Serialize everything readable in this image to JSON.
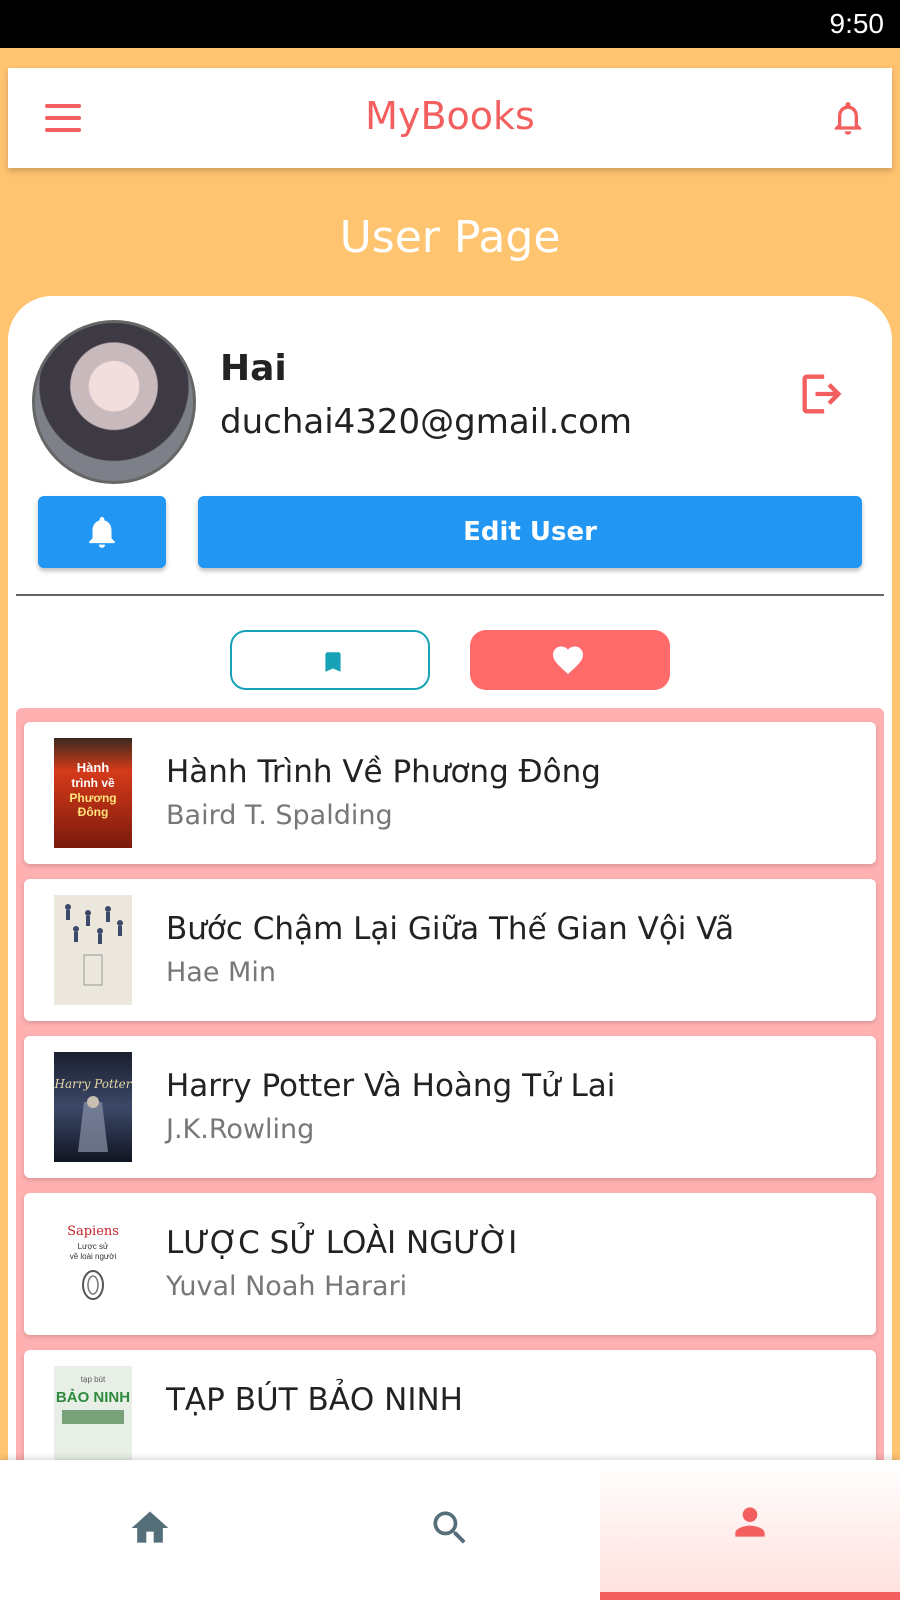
{
  "status_bar": {
    "time": "9:50"
  },
  "app_bar": {
    "title": "MyBooks",
    "menu_icon": "hamburger-menu-icon",
    "bell_icon": "bell-outline-icon"
  },
  "page": {
    "title": "User Page"
  },
  "user": {
    "name": "Hai",
    "email": "duchai4320@gmail.com"
  },
  "buttons": {
    "edit_label": "Edit User",
    "bell_icon": "bell-icon",
    "logout_icon": "logout-icon"
  },
  "tabs": {
    "saved_icon": "bookmark-icon",
    "favorite_icon": "heart-icon",
    "active": "favorite"
  },
  "books": [
    {
      "title": "Hành Trình Về Phương Đông",
      "author": "Baird T. Spalding",
      "cover_text": "Hành trình về Phương Đông",
      "cover_color": "#c8321c"
    },
    {
      "title": "Bước Chậm Lại Giữa Thế Gian Vội Vã",
      "author": "Hae Min",
      "cover_text": "",
      "cover_color": "#ece7dc"
    },
    {
      "title": "Harry Potter Và Hoàng Tử Lai",
      "author": "J.K.Rowling",
      "cover_text": "Harry Potter",
      "cover_color": "#2c3450"
    },
    {
      "title": "LƯỢC SỬ LOÀI NGƯỜI",
      "author": "Yuval Noah Harari",
      "cover_text": "Sapiens Lược sử về loài người",
      "cover_color": "#ffffff"
    },
    {
      "title": "TẠP BÚT BẢO NINH",
      "author": "",
      "cover_text": "tạp bút BẢO NINH",
      "cover_color": "#e8efe6"
    }
  ],
  "bottom_nav": [
    {
      "icon": "home-icon",
      "active": false
    },
    {
      "icon": "search-icon",
      "active": false
    },
    {
      "icon": "person-icon",
      "active": true
    }
  ],
  "colors": {
    "accent": "#f35f5f",
    "primary_blue": "#2196f3",
    "background": "#ffc470",
    "list_bg": "#ffb0b0",
    "teal": "#17a2b8"
  }
}
